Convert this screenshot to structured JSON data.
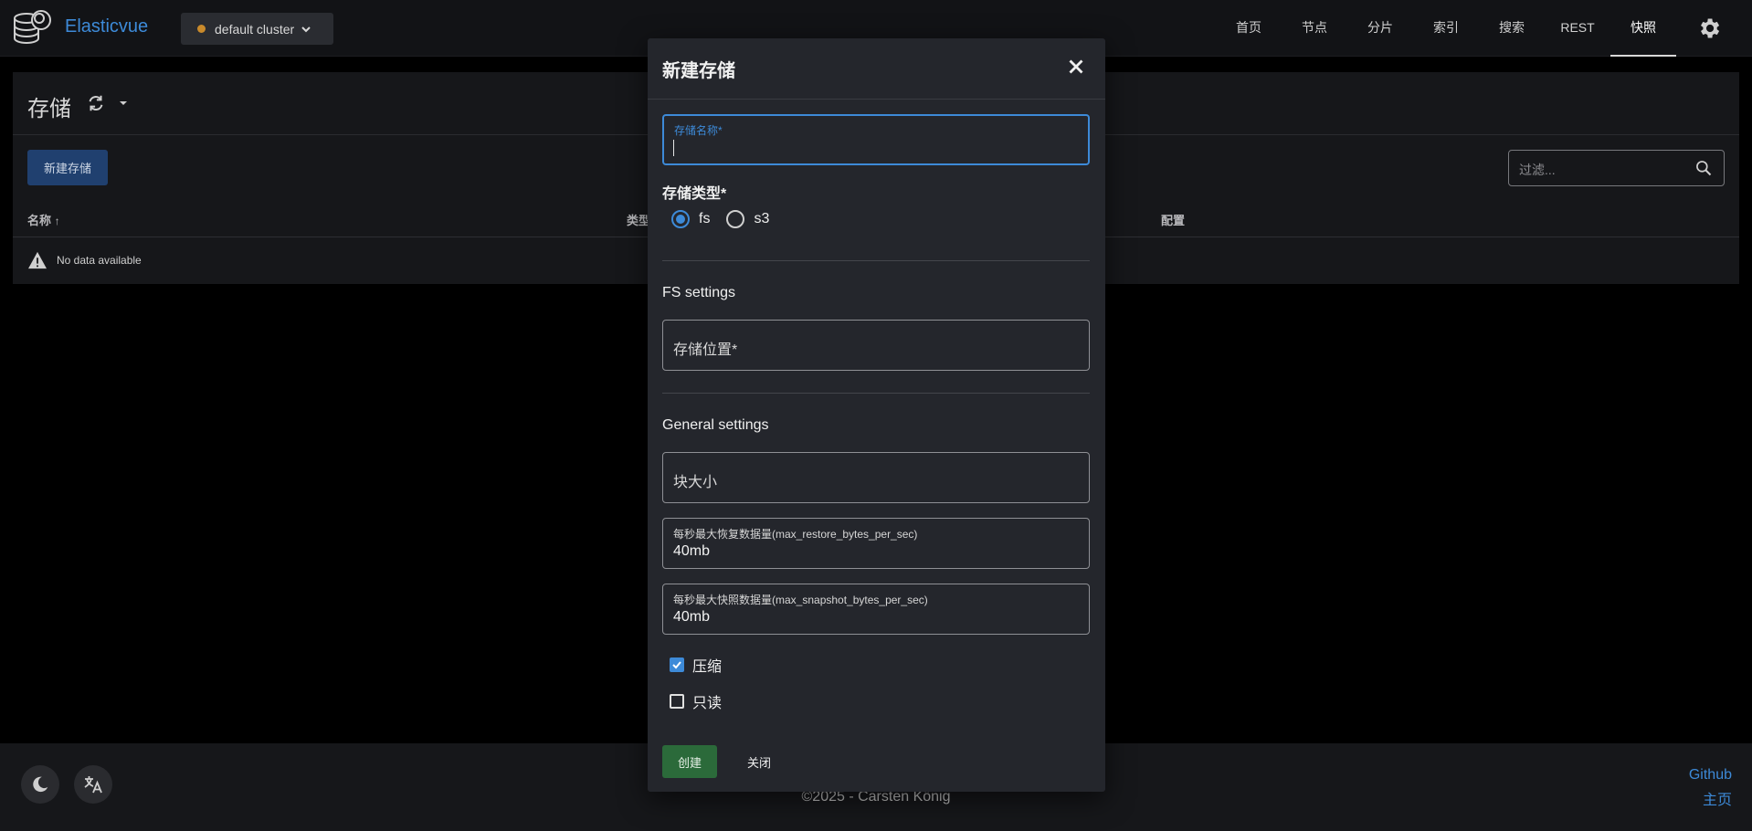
{
  "header": {
    "brand": "Elasticvue",
    "cluster": "default cluster",
    "nav": [
      {
        "label": "首页"
      },
      {
        "label": "节点"
      },
      {
        "label": "分片"
      },
      {
        "label": "索引"
      },
      {
        "label": "搜索"
      },
      {
        "label": "REST"
      },
      {
        "label": "快照",
        "active": true
      }
    ],
    "cluster_status_color": "#c98a2b",
    "accent_color": "#3d8ad8"
  },
  "page": {
    "title": "存储",
    "new_button": "新建存储",
    "filter_placeholder": "过滤...",
    "columns": [
      "名称",
      "类型",
      "配置"
    ],
    "sort_indicator": "↑",
    "empty_text": "No data available"
  },
  "footer": {
    "copyright": "©2025 - Carsten König",
    "links": [
      "Github",
      "主页"
    ]
  },
  "dialog": {
    "title": "新建存储",
    "name_label": "存储名称*",
    "name_value": "",
    "type_label": "存储类型*",
    "type_options": [
      "fs",
      "s3"
    ],
    "type_selected": "fs",
    "fs_section": "FS settings",
    "location_label": "存储位置*",
    "general_section": "General settings",
    "chunk_size_label": "块大小",
    "max_restore_label": "每秒最大恢复数据量(max_restore_bytes_per_sec)",
    "max_restore_value": "40mb",
    "max_snapshot_label": "每秒最大快照数据量(max_snapshot_bytes_per_sec)",
    "max_snapshot_value": "40mb",
    "compress_label": "压缩",
    "compress_checked": true,
    "readonly_label": "只读",
    "readonly_checked": false,
    "create_button": "创建",
    "close_button": "关闭"
  }
}
